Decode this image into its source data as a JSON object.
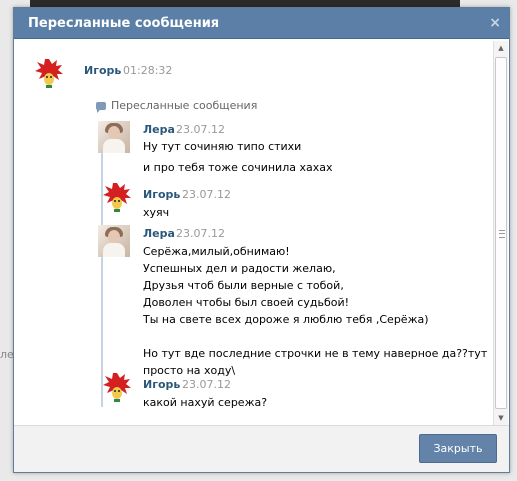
{
  "dialog": {
    "title": "Пересланные сообщения",
    "close_icon": "×",
    "forwarded_label": "Пересланные сообщения",
    "close_button": "Закрыть"
  },
  "outer": {
    "author": "Игорь",
    "time": "01:28:32"
  },
  "messages": [
    {
      "author": "Лера",
      "date": "23.07.12",
      "avatar": "lera-photo",
      "lines": [
        "Ну тут сочиняю типо стихи",
        "и про тебя тоже сочинила хахах"
      ]
    },
    {
      "author": "Игорь",
      "date": "23.07.12",
      "avatar": "red-haired-cartoon",
      "lines": [
        "хуяч"
      ]
    },
    {
      "author": "Лера",
      "date": "23.07.12",
      "avatar": "lera-photo",
      "lines": [
        "Серёжа,милый,обнимаю!",
        "Успешных дел и радости желаю,",
        "Друзья чтоб были верные с тобой,",
        "Доволен чтобы был своей судьбой!",
        "Ты на свете всех дороже я люблю тебя ,Серёжа)",
        "",
        "Но тут вде последние строчки не в тему наверное да??тут",
        "просто на ходу\\"
      ]
    },
    {
      "author": "Игорь",
      "date": "23.07.12",
      "avatar": "red-haired-cartoon",
      "lines": [
        "какой нахуй сережа?"
      ]
    }
  ],
  "background": {
    "side_text": "лен"
  },
  "colors": {
    "title_bar": "#5b7fa6",
    "author_name": "#2b587a",
    "button": "#6383a8"
  }
}
